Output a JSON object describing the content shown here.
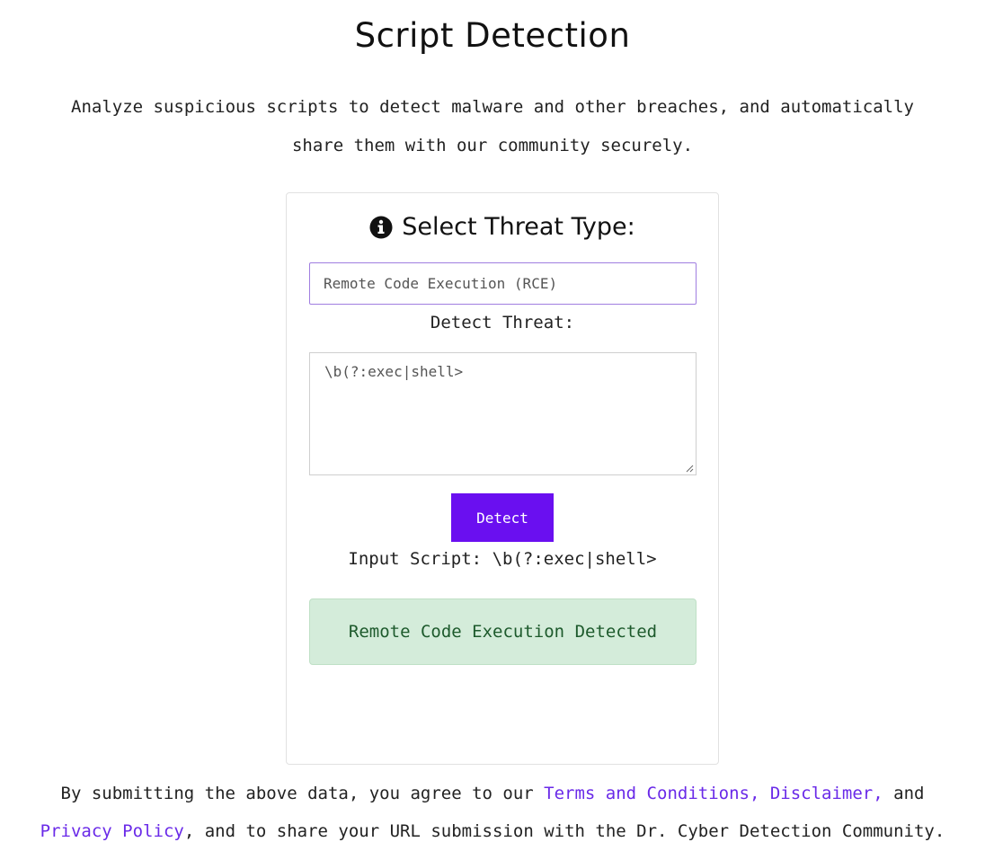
{
  "page": {
    "title": "Script Detection",
    "intro": "Analyze suspicious scripts to detect malware and other breaches, and automatically share them with our community securely."
  },
  "card": {
    "heading": "Select Threat Type:",
    "heading_icon": "info-circle-icon",
    "threat_select": {
      "selected": "Remote Code Execution (RCE)"
    },
    "detect_label": "Detect Threat:",
    "script_input": {
      "value": "\\b(?:exec|shell>"
    },
    "detect_button": "Detect",
    "input_script_prefix": "Input Script:",
    "input_script_value": "\\b(?:exec|shell>",
    "result_text": "Remote Code Execution Detected"
  },
  "footer": {
    "text_1": "By submitting the above data, you agree to our ",
    "link_terms": "Terms and Conditions,",
    "link_disclaimer": "Disclaimer,",
    "text_2": " and",
    "link_privacy": "Privacy Policy",
    "text_3": ", and to share your URL submission with the Dr. Cyber Detection Community."
  },
  "colors": {
    "accent": "#6a0ff0",
    "link": "#6a2ae8",
    "select_border": "#a07ee0",
    "success_bg": "#d4ecda",
    "success_text": "#1d5a2c"
  }
}
